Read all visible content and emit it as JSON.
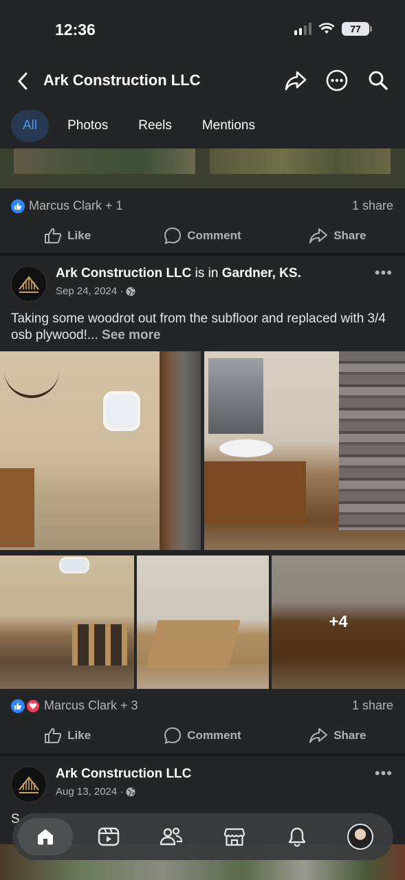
{
  "status_bar": {
    "time": "12:36",
    "battery": "77"
  },
  "header": {
    "page_name": "Ark Construction LLC"
  },
  "tabs": [
    {
      "label": "All",
      "active": true
    },
    {
      "label": "Photos",
      "active": false
    },
    {
      "label": "Reels",
      "active": false
    },
    {
      "label": "Mentions",
      "active": false
    }
  ],
  "previous_post": {
    "reactions_text": "Marcus Clark + 1",
    "shares": "1 share"
  },
  "action_labels": {
    "like": "Like",
    "comment": "Comment",
    "share": "Share"
  },
  "post1": {
    "author": "Ark Construction LLC",
    "is_in": "is in",
    "location": "Gardner, KS.",
    "date": "Sep 24, 2024 ·",
    "text": "Taking some woodrot out from the subfloor and replaced with 3/4 osb plywood!...",
    "see_more": "See more",
    "more_photos": "+4",
    "reactions_text": "Marcus Clark + 3",
    "shares": "1 share"
  },
  "post2": {
    "author": "Ark Construction LLC",
    "date": "Aug 13, 2024 ·",
    "text_start": "S"
  },
  "icons": {
    "back": "chevron-left-icon",
    "share": "share-arrow-icon",
    "more": "ellipsis-icon",
    "search": "search-icon",
    "privacy": "globe-icon"
  },
  "colors": {
    "accent": "#2d88ff",
    "love": "#f33e58",
    "background": "#242526"
  }
}
